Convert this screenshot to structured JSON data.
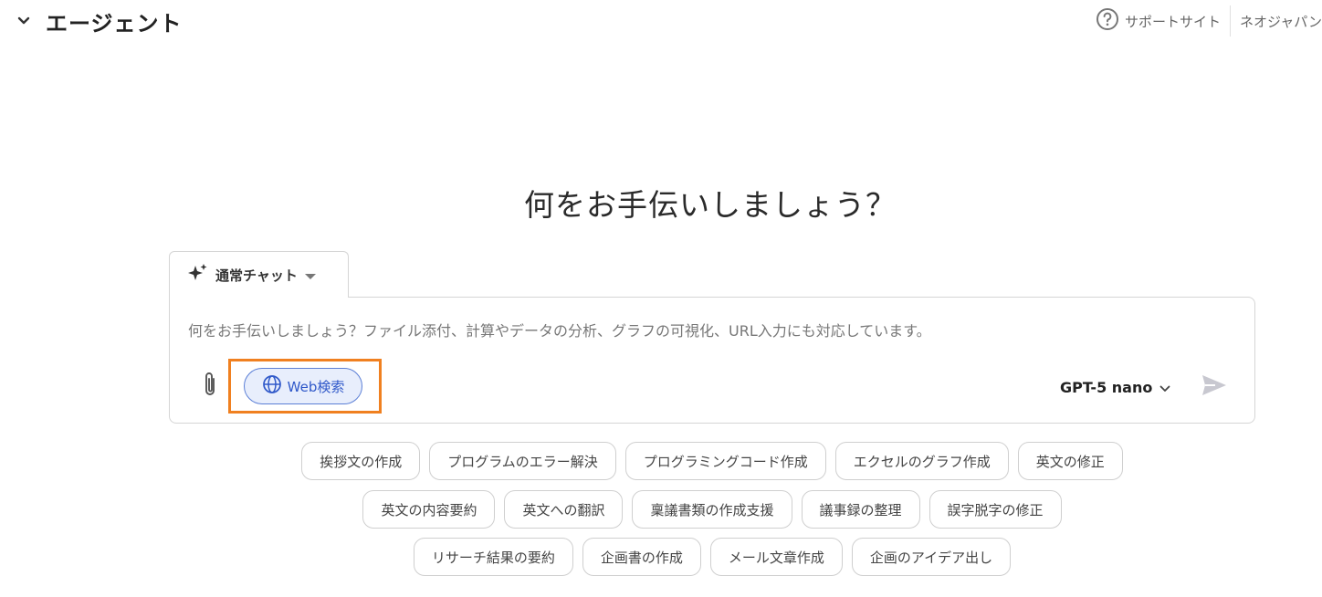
{
  "header": {
    "title": "エージェント",
    "collapse_icon": "chevron-down-icon",
    "support_icon": "help-circle-icon",
    "support_label": "サポートサイト",
    "org_name": "ネオジャパン"
  },
  "main": {
    "heading": "何をお手伝いしましょう？"
  },
  "mode": {
    "icon": "sparkle-icon",
    "label": "通常チャット",
    "dropdown_icon": "caret-down-icon"
  },
  "composer": {
    "placeholder": "何をお手伝いしましょう？ファイル添付、計算やデータの分析、グラフの可視化、URL入力にも対応しています。",
    "value": "",
    "attach_icon": "paperclip-icon",
    "web_search": {
      "icon": "globe-icon",
      "label": "Web検索",
      "active": true
    },
    "model": {
      "label": "GPT-5 nano",
      "icon": "chevron-down-icon"
    },
    "send_icon": "send-icon"
  },
  "suggestions": [
    [
      "挨拶文の作成",
      "プログラムのエラー解決",
      "プログラミングコード作成",
      "エクセルのグラフ作成",
      "英文の修正"
    ],
    [
      "英文の内容要約",
      "英文への翻訳",
      "稟議書類の作成支援",
      "議事録の整理",
      "誤字脱字の修正"
    ],
    [
      "リサーチ結果の要約",
      "企画書の作成",
      "メール文章作成",
      "企画のアイデア出し"
    ]
  ],
  "colors": {
    "highlight": "#f08020",
    "web_search_border": "#5b7fd6",
    "web_search_bg": "#e8eefc",
    "web_search_text": "#2f58c9",
    "send_icon": "#c8c8d0"
  }
}
